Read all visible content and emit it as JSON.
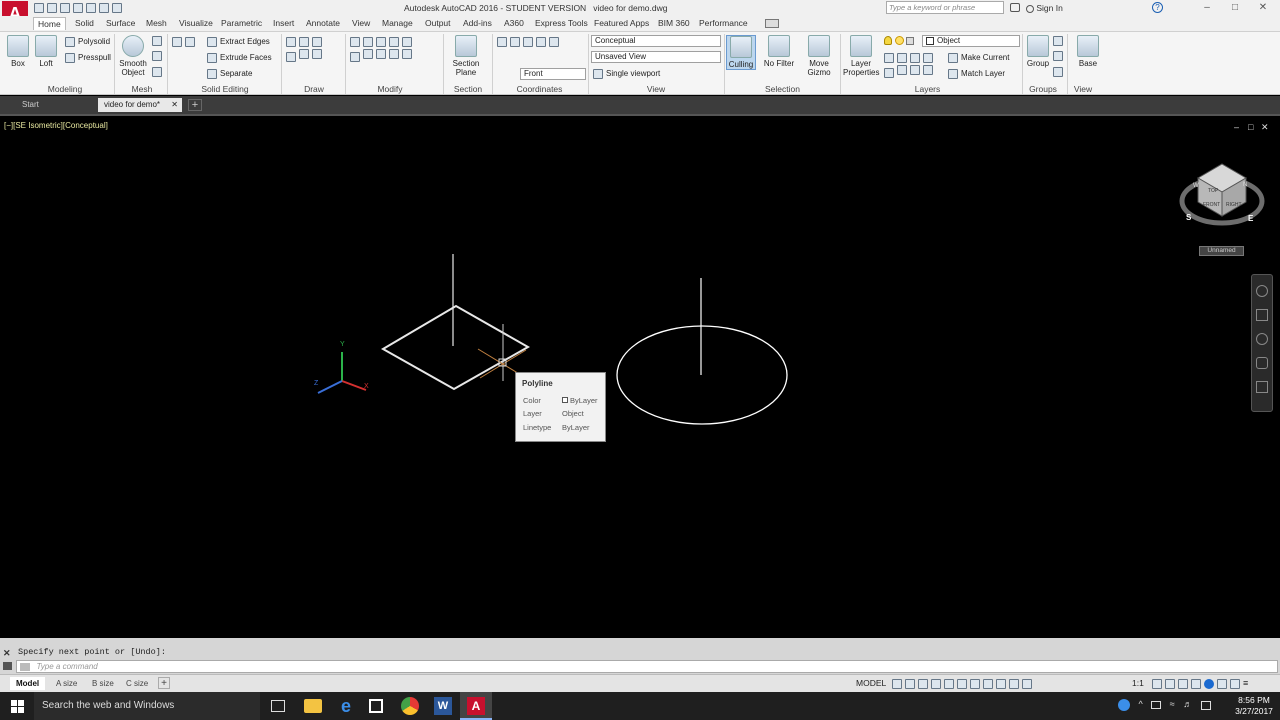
{
  "title": {
    "app": "Autodesk AutoCAD 2016 - STUDENT VERSION",
    "file": "video for demo.dwg",
    "search_placeholder": "Type a keyword or phrase",
    "sign_in": "Sign In"
  },
  "ribbon_tabs": [
    "Home",
    "Solid",
    "Surface",
    "Mesh",
    "Visualize",
    "Parametric",
    "Insert",
    "Annotate",
    "View",
    "Manage",
    "Output",
    "Add-ins",
    "A360",
    "Express Tools",
    "Featured Apps",
    "BIM 360",
    "Performance"
  ],
  "modeling": {
    "box": "Box",
    "loft": "Loft",
    "polysolid": "Polysolid",
    "presspull": "Presspull",
    "title": "Modeling"
  },
  "mesh": {
    "smooth1": "Smooth",
    "smooth2": "Object",
    "title": "Mesh"
  },
  "solid_editing": {
    "extract": "Extract Edges",
    "extrude": "Extrude Faces",
    "separate": "Separate",
    "title": "Solid Editing"
  },
  "draw": {
    "title": "Draw"
  },
  "modify": {
    "title": "Modify"
  },
  "section": {
    "l1": "Section",
    "l2": "Plane",
    "title": "Section"
  },
  "coordinates": {
    "title": "Coordinates",
    "front": "Front"
  },
  "view": {
    "visual_style": "Conceptual",
    "named_view": "Unsaved View",
    "viewport": "Single viewport",
    "title": "View"
  },
  "selection": {
    "culling": "Culling",
    "nofilter": "No Filter",
    "move1": "Move",
    "move2": "Gizmo",
    "title": "Selection"
  },
  "layers": {
    "lp1": "Layer",
    "lp2": "Properties",
    "layer_name": "Object",
    "make_current": "Make Current",
    "match_layer": "Match Layer",
    "title": "Layers"
  },
  "groups": {
    "group": "Group",
    "title": "Groups"
  },
  "viewpanel": {
    "base": "Base",
    "title": "View"
  },
  "doc_tabs": {
    "start": "Start",
    "doc": "video for demo*"
  },
  "viewport_label": "[−][SE Isometric][Conceptual]",
  "viewcube": {
    "top": "TOP",
    "front": "FRONT",
    "right": "RIGHT",
    "wcs": "Unnamed",
    "compass_s": "S",
    "compass_e": "E",
    "compass_n": "N",
    "compass_w": "W"
  },
  "ucs": {
    "x": "X",
    "y": "Y",
    "z": "Z"
  },
  "tooltip": {
    "title": "Polyline",
    "color_label": "Color",
    "color_value": "ByLayer",
    "layer_label": "Layer",
    "layer_value": "Object",
    "linetype_label": "Linetype",
    "linetype_value": "ByLayer"
  },
  "command": {
    "history": "Specify next point or [Undo]:",
    "placeholder": "Type a command"
  },
  "layout_tabs": [
    "Model",
    "A size",
    "B size",
    "C size"
  ],
  "status": {
    "model": "MODEL",
    "scale": "1:1"
  },
  "taskbar": {
    "search": "Search the web and Windows",
    "time": "8:56 PM",
    "date": "3/27/2017"
  }
}
